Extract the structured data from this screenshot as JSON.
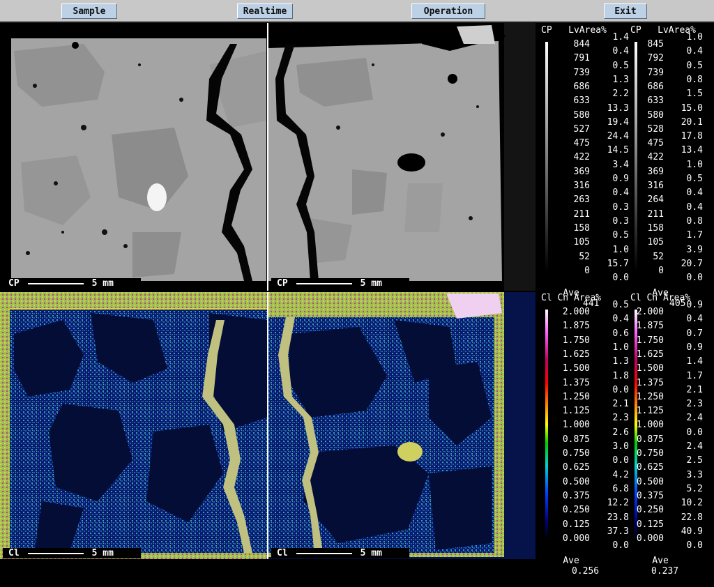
{
  "toolbar": {
    "buttons": [
      "Sample",
      "Realtime",
      "Operation",
      "Exit"
    ]
  },
  "panels": [
    {
      "label": "CP",
      "scale": "5 mm"
    },
    {
      "label": "CP",
      "scale": "5 mm"
    },
    {
      "label": "Cl",
      "scale": "5 mm"
    },
    {
      "label": "Cl",
      "scale": "5 mm"
    }
  ],
  "legends": {
    "cp_left": {
      "header": "CP   LvArea%",
      "levels": [
        "844",
        "791",
        "739",
        "686",
        "633",
        "580",
        "527",
        "475",
        "422",
        "369",
        "316",
        "263",
        "211",
        "158",
        "105",
        "52",
        "0"
      ],
      "areas": [
        "1.4",
        "0.4",
        "0.5",
        "1.3",
        "2.2",
        "13.3",
        "19.4",
        "24.4",
        "14.5",
        "3.4",
        "0.9",
        "0.4",
        "0.3",
        "0.3",
        "0.5",
        "1.0",
        "15.7",
        "0.0"
      ],
      "ave_label": "Ave",
      "ave_value": "441"
    },
    "cp_right": {
      "header": "CP   LvArea%",
      "levels": [
        "845",
        "792",
        "739",
        "686",
        "633",
        "580",
        "528",
        "475",
        "422",
        "369",
        "316",
        "264",
        "211",
        "158",
        "105",
        "52",
        "0"
      ],
      "areas": [
        "1.0",
        "0.4",
        "0.5",
        "0.8",
        "1.5",
        "15.0",
        "20.1",
        "17.8",
        "13.4",
        "1.0",
        "0.5",
        "0.4",
        "0.4",
        "0.8",
        "1.7",
        "3.9",
        "20.7",
        "0.0"
      ],
      "ave_label": "Ave",
      "ave_value": "405"
    },
    "cl_left": {
      "header": "Cl Cn Area%",
      "levels": [
        "2.000",
        "1.875",
        "1.750",
        "1.625",
        "1.500",
        "1.375",
        "1.250",
        "1.125",
        "1.000",
        "0.875",
        "0.750",
        "0.625",
        "0.500",
        "0.375",
        "0.250",
        "0.125",
        "0.000"
      ],
      "areas": [
        "0.5",
        "0.4",
        "0.6",
        "1.0",
        "1.3",
        "1.8",
        "0.0",
        "2.1",
        "2.3",
        "2.6",
        "3.0",
        "0.0",
        "4.2",
        "6.8",
        "12.2",
        "23.8",
        "37.3",
        "0.0"
      ],
      "ave_label": "Ave",
      "ave_value": "0.256"
    },
    "cl_right": {
      "header": "Cl Cn Area%",
      "levels": [
        "2.000",
        "1.875",
        "1.750",
        "1.625",
        "1.500",
        "1.375",
        "1.250",
        "1.125",
        "1.000",
        "0.875",
        "0.750",
        "0.625",
        "0.500",
        "0.375",
        "0.250",
        "0.125",
        "0.000"
      ],
      "areas": [
        "0.9",
        "0.4",
        "0.7",
        "0.9",
        "1.4",
        "1.7",
        "2.1",
        "2.3",
        "2.4",
        "0.0",
        "2.4",
        "2.5",
        "3.3",
        "5.2",
        "10.2",
        "22.8",
        "40.9",
        "0.0"
      ],
      "ave_label": "Ave",
      "ave_value": "0.237"
    }
  },
  "colors": {
    "toolbar_bg": "#c8c8c8",
    "button_bg": "#bcd0e6",
    "cl_background": "#05103a",
    "cl_high": "#f0d040"
  }
}
